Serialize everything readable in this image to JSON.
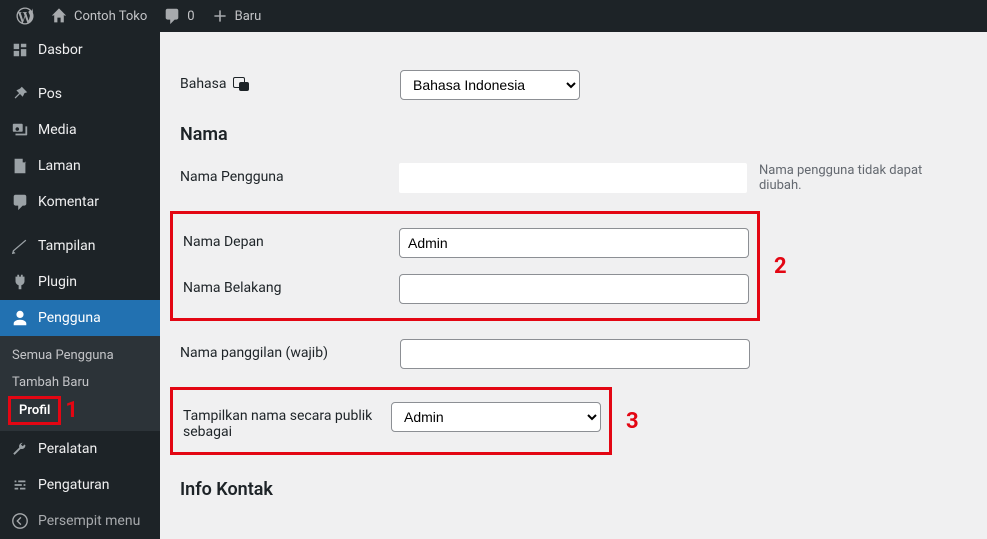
{
  "topbar": {
    "site_name": "Contoh Toko",
    "comments_count": "0",
    "new_label": "Baru"
  },
  "sidebar": {
    "items": [
      {
        "label": "Dasbor"
      },
      {
        "label": "Pos"
      },
      {
        "label": "Media"
      },
      {
        "label": "Laman"
      },
      {
        "label": "Komentar"
      },
      {
        "label": "Tampilan"
      },
      {
        "label": "Plugin"
      },
      {
        "label": "Pengguna"
      },
      {
        "label": "Peralatan"
      },
      {
        "label": "Pengaturan"
      },
      {
        "label": "Persempit menu"
      }
    ],
    "sub_users": {
      "all": "Semua Pengguna",
      "add": "Tambah Baru",
      "profile": "Profil"
    }
  },
  "form": {
    "language_label": "Bahasa",
    "language_value": "Bahasa Indonesia",
    "section_name": "Nama",
    "username_label": "Nama Pengguna",
    "username_note": "Nama pengguna tidak dapat diubah.",
    "firstname_label": "Nama Depan",
    "firstname_value": "Admin",
    "lastname_label": "Nama Belakang",
    "lastname_value": "",
    "nickname_label": "Nama panggilan (wajib)",
    "nickname_value": "",
    "display_label": "Tampilkan nama secara publik sebagai",
    "display_value": "Admin",
    "section_contact": "Info Kontak"
  },
  "annotations": {
    "one": "1",
    "two": "2",
    "three": "3"
  }
}
